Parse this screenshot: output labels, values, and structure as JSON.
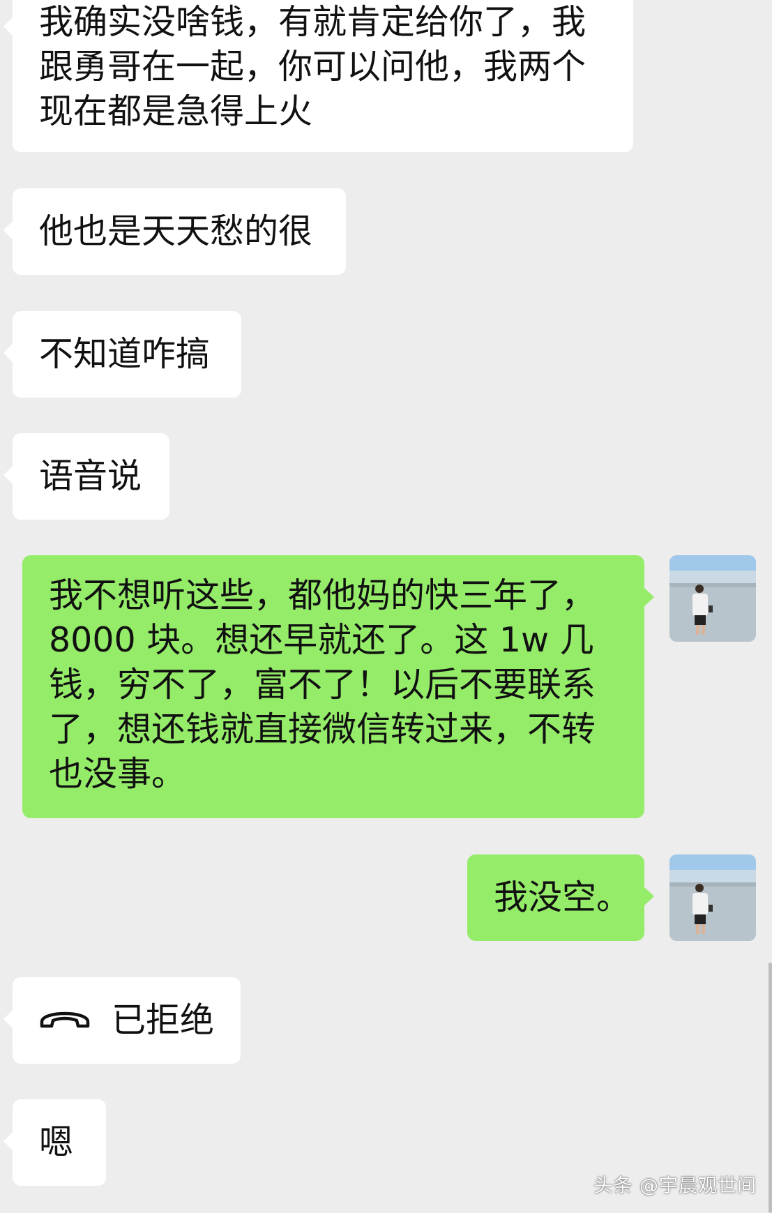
{
  "messages": [
    {
      "side": "in",
      "lines": [
        "我确实没啥钱，有就肯定给你了，我",
        "跟勇哥在一起，你可以问他，我两个",
        "现在都是急得上火"
      ]
    },
    {
      "side": "in",
      "lines": [
        "他也是天天愁的很"
      ]
    },
    {
      "side": "in",
      "lines": [
        "不知道咋搞"
      ]
    },
    {
      "side": "in",
      "lines": [
        "语音说"
      ]
    },
    {
      "side": "out",
      "lines": [
        "我不想听这些，都他妈的快三年了，",
        "8000 块。想还早就还了。这 1w 几",
        "钱，穷不了，富不了！以后不要联系",
        "了，想还钱就直接微信转过来，不转",
        "也没事。"
      ]
    },
    {
      "side": "out",
      "lines": [
        "我没空。"
      ]
    },
    {
      "side": "in",
      "type": "call",
      "icon": "phone-hangup-icon",
      "text": "已拒绝"
    },
    {
      "side": "in",
      "lines": [
        "嗯"
      ]
    }
  ],
  "watermark": "头条 @宇晨观世间",
  "colors": {
    "background": "#ededed",
    "incoming_bubble": "#ffffff",
    "outgoing_bubble": "#95ec69"
  }
}
